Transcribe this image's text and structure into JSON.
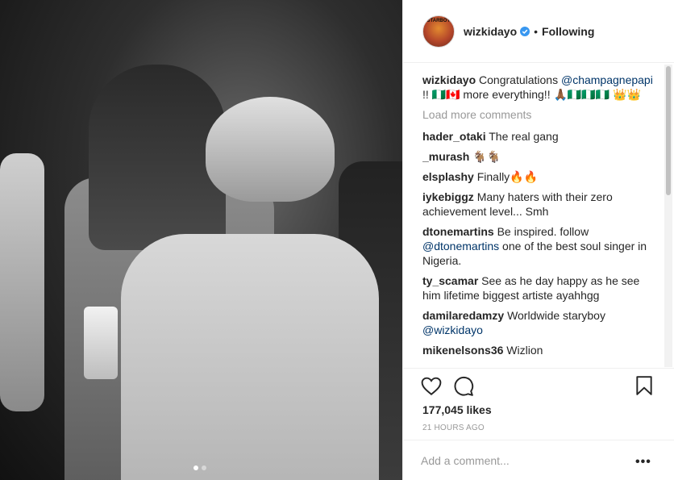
{
  "post": {
    "username": "wizkidayo",
    "follow_dot": "•",
    "follow_status": "Following",
    "avatar_text": "STARBOY"
  },
  "caption": {
    "user": "wizkidayo",
    "text_before": "Congratulations",
    "mention": "@champagnepapi",
    "text_after": "!! 🇳🇬🇨🇦 more everything!! 🙏🏾🇳🇬🇳🇬🇳🇬 👑👑"
  },
  "load_more_label": "Load more comments",
  "comments": [
    {
      "user": "hader_otaki",
      "text": "The real gang"
    },
    {
      "user": "_murash",
      "text": "🐐🐐"
    },
    {
      "user": "elsplashy",
      "text": "Finally🔥🔥"
    },
    {
      "user": "iykebiggz",
      "text": "Many haters with their zero achievement level... Smh"
    },
    {
      "user": "dtonemartins",
      "text_before": "Be inspired. follow",
      "mention": "@dtonemartins",
      "text_after": "one of the best soul singer in Nigeria."
    },
    {
      "user": "ty_scamar",
      "text": "See as he day happy as he see him lifetime biggest artiste ayahhgg"
    },
    {
      "user": "damilaredamzy",
      "text_before": "Worldwide staryboy",
      "mention": "@wizkidayo",
      "text_after": ""
    },
    {
      "user": "mikenelsons36",
      "text": "Wizlion"
    }
  ],
  "likes": "177,045 likes",
  "time_ago": "21 HOURS AGO",
  "add_comment_placeholder": "Add a comment...",
  "more_label": "•••"
}
